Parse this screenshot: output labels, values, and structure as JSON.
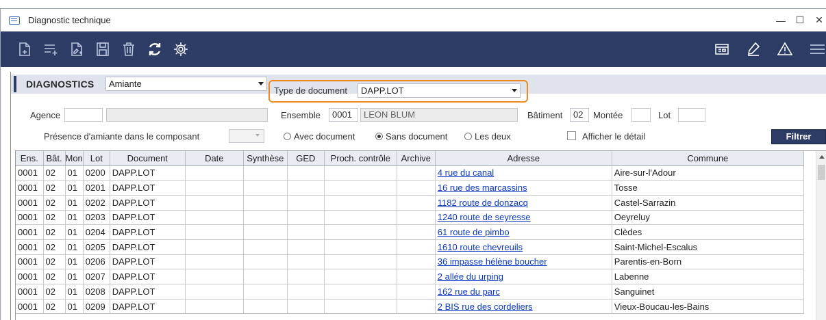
{
  "window": {
    "title": "Diagnostic technique",
    "minimize": "—",
    "maximize": "☐",
    "close": "✕"
  },
  "toolbar": {
    "left_icons": [
      "new-document-icon",
      "add-list-icon",
      "edit-document-icon",
      "save-icon",
      "delete-icon",
      "refresh-icon",
      "settings-icon"
    ],
    "right_icons": [
      "view-icon",
      "signature-icon",
      "warning-icon",
      "menu-icon"
    ]
  },
  "header": {
    "section_title": "DIAGNOSTICS",
    "diagnostic_type": "Amiante",
    "doc_type_label": "Type de document",
    "doc_type_value": "DAPP.LOT"
  },
  "filters": {
    "agence_label": "Agence",
    "agence_code": "",
    "agence_name": "",
    "ensemble_label": "Ensemble",
    "ensemble_code": "0001",
    "ensemble_name": "LEON BLUM",
    "batiment_label": "Bâtiment",
    "batiment_value": "02",
    "montee_label": "Montée",
    "montee_value": "",
    "lot_label": "Lot",
    "lot_value": "",
    "presence_label": "Présence d'amiante dans le composant",
    "radio_avec": "Avec document",
    "radio_sans": "Sans document",
    "radio_deux": "Les deux",
    "selected_radio": "Sans document",
    "afficher_label": "Afficher le détail",
    "afficher_checked": false,
    "filter_button": "Filtrer"
  },
  "grid": {
    "columns": [
      "Ens.",
      "Bât.",
      "Mon",
      "Lot",
      "Document",
      "Date",
      "Synthèse",
      "GED",
      "Proch. contrôle",
      "Archive",
      "Adresse",
      "Commune"
    ],
    "rows": [
      [
        "0001",
        "02",
        "01",
        "0200",
        "DAPP.LOT",
        "",
        "",
        "",
        "",
        "",
        "4 rue du canal",
        "Aire-sur-l'Adour"
      ],
      [
        "0001",
        "02",
        "01",
        "0201",
        "DAPP.LOT",
        "",
        "",
        "",
        "",
        "",
        "16 rue des marcassins",
        "Tosse"
      ],
      [
        "0001",
        "02",
        "01",
        "0202",
        "DAPP.LOT",
        "",
        "",
        "",
        "",
        "",
        "1182 route de donzacq",
        "Castel-Sarrazin"
      ],
      [
        "0001",
        "02",
        "01",
        "0203",
        "DAPP.LOT",
        "",
        "",
        "",
        "",
        "",
        "1240 route de seyresse",
        "Oeyreluy"
      ],
      [
        "0001",
        "02",
        "01",
        "0204",
        "DAPP.LOT",
        "",
        "",
        "",
        "",
        "",
        "61 route de pimbo",
        "Clèdes"
      ],
      [
        "0001",
        "02",
        "01",
        "0205",
        "DAPP.LOT",
        "",
        "",
        "",
        "",
        "",
        "1610 route chevreuils",
        "Saint-Michel-Escalus"
      ],
      [
        "0001",
        "02",
        "01",
        "0206",
        "DAPP.LOT",
        "",
        "",
        "",
        "",
        "",
        "36 impasse hélène boucher",
        "Parentis-en-Born"
      ],
      [
        "0001",
        "02",
        "01",
        "0207",
        "DAPP.LOT",
        "",
        "",
        "",
        "",
        "",
        "2 allée du urping",
        "Labenne"
      ],
      [
        "0001",
        "02",
        "01",
        "0208",
        "DAPP.LOT",
        "",
        "",
        "",
        "",
        "",
        "162 rue du parc",
        "Sanguinet"
      ],
      [
        "0001",
        "02",
        "01",
        "0209",
        "DAPP.LOT",
        "",
        "",
        "",
        "",
        "",
        "2 BIS rue des cordeliers",
        "Vieux-Boucau-les-Bains"
      ]
    ]
  },
  "colors": {
    "toolbar_bg": "#2c3c64",
    "highlight": "#f08a24",
    "link": "#0b38c0"
  }
}
